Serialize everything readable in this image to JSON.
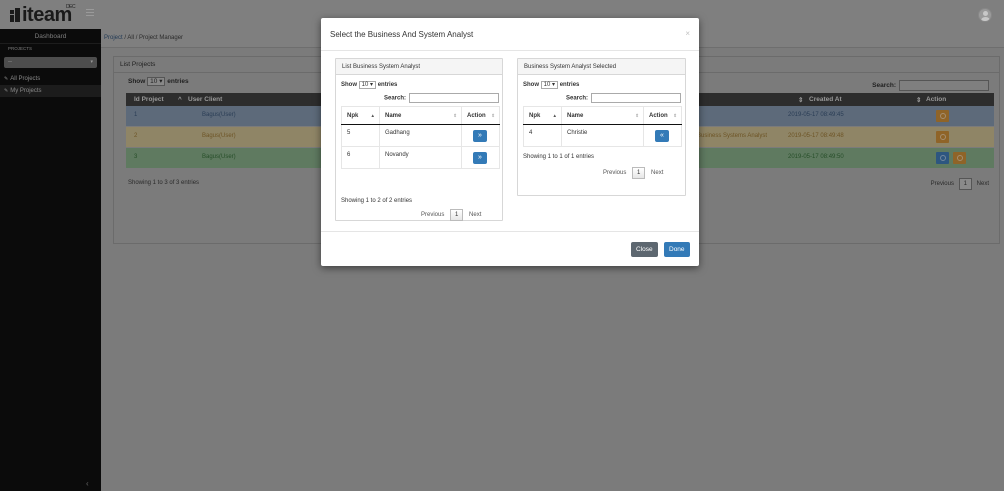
{
  "app": {
    "logo_text": "iteam",
    "logo_sup": "DEC"
  },
  "sidebar": {
    "dashboard": "Dashboard",
    "section": "PROJECTS",
    "select_value": "--",
    "items": [
      {
        "label": "All Projects",
        "icon": "pencil-icon"
      },
      {
        "label": "My Projects",
        "icon": "pencil-icon"
      }
    ]
  },
  "breadcrumb": {
    "first": "Project",
    "rest": " / All / Project Manager"
  },
  "list_projects": {
    "title": "List Projects",
    "show_prefix": "Show",
    "show_value": "10",
    "show_suffix": "entries",
    "search_label": "Search:",
    "columns": {
      "id": "Id Project",
      "user": "User Client",
      "created": "Created At",
      "action": "Action"
    },
    "rows": [
      {
        "id": "1",
        "user": "Bagus(User)",
        "status": "",
        "created": "2019-05-17 08:49:45"
      },
      {
        "id": "2",
        "user": "Bagus(User)",
        "status": "Business Systems Analyst",
        "created": "2019-05-17 08:49:48"
      },
      {
        "id": "3",
        "user": "Bagus(User)",
        "status": "",
        "created": "2019-05-17 08:49:50"
      }
    ],
    "info": "Showing 1 to 3 of 3 entries",
    "pager": {
      "prev": "Previous",
      "page": "1",
      "next": "Next"
    }
  },
  "modal": {
    "title": "Select the Business And System Analyst",
    "close_glyph": "×",
    "left": {
      "title": "List Business System Analyst",
      "show_prefix": "Show",
      "show_value": "10",
      "show_suffix": "entries",
      "search_label": "Search:",
      "columns": {
        "npk": "Npk",
        "name": "Name",
        "action": "Action"
      },
      "rows": [
        {
          "npk": "5",
          "name": "Gadhang",
          "btn": "»"
        },
        {
          "npk": "6",
          "name": "Novandy",
          "btn": "»"
        }
      ],
      "info": "Showing 1 to 2 of 2 entries",
      "pager": {
        "prev": "Previous",
        "page": "1",
        "next": "Next"
      }
    },
    "right": {
      "title": "Business System Analyst Selected",
      "show_prefix": "Show",
      "show_value": "10",
      "show_suffix": "entries",
      "search_label": "Search:",
      "columns": {
        "npk": "Npk",
        "name": "Name",
        "action": "Action"
      },
      "rows": [
        {
          "npk": "4",
          "name": "Christie",
          "btn": "«"
        }
      ],
      "info": "Showing 1 to 1 of 1 entries",
      "pager": {
        "prev": "Previous",
        "page": "1",
        "next": "Next"
      }
    },
    "footer": {
      "close": "Close",
      "done": "Done"
    }
  },
  "colors": {
    "primary": "#337ab7",
    "close_btn": "#5d6770",
    "warning": "#f0a030"
  }
}
